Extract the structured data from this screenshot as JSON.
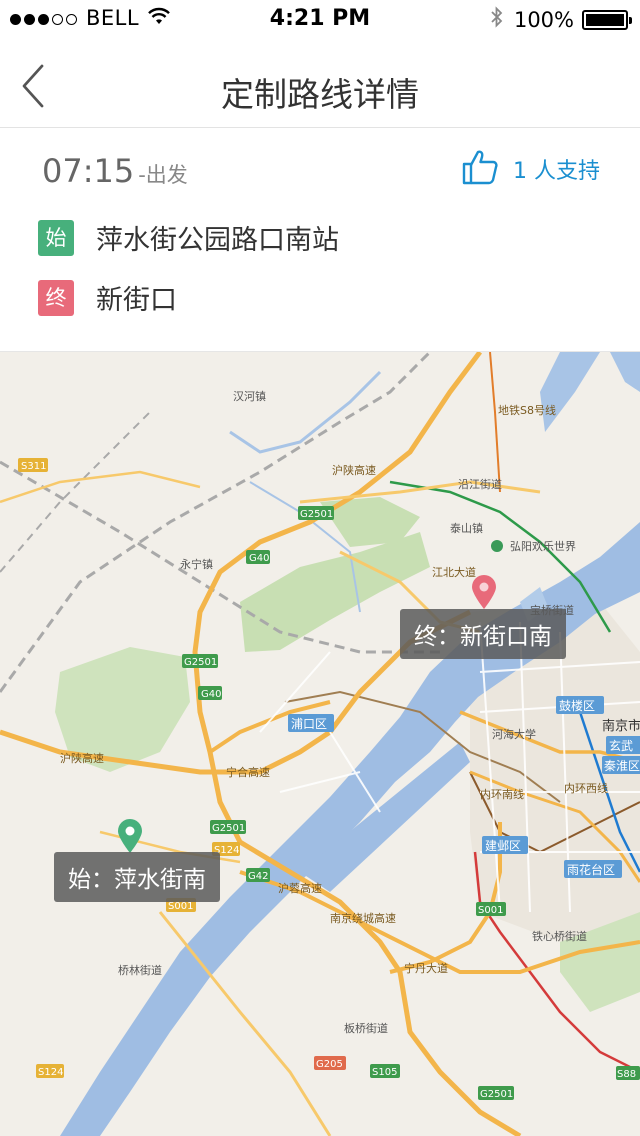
{
  "status_bar": {
    "carrier": "BELL",
    "time": "4:21 PM",
    "battery": "100%"
  },
  "nav": {
    "title": "定制路线详情"
  },
  "route": {
    "departure_time": "07:15",
    "departure_suffix": "-出发",
    "support_label": "1 人支持",
    "start_badge": "始",
    "start_name": "萍水街公园路口南站",
    "end_badge": "终",
    "end_name": "新街口"
  },
  "map": {
    "start_label": "始：萍水街南",
    "end_label": "终：新街口南",
    "places": {
      "hanhe": "汉河镇",
      "yongning": "永宁镇",
      "yanjiang": "沿江街道",
      "taishan": "泰山镇",
      "hongyang": "弘阳欢乐世界",
      "baoqiao": "宝桥街道",
      "pukou": "浦口区",
      "gulou": "鼓楼区",
      "nanjing": "南京市",
      "hohai": "河海大学",
      "xuanwu": "玄武",
      "qinhuai": "秦淮区",
      "jianye": "建邺区",
      "yuhuatai": "雨花台区",
      "tiexinqiao": "铁心桥街道",
      "qiaolin": "桥林街道",
      "banqiao": "板桥街道",
      "ningyu_hwy": "宁合高速",
      "hushan_hwy": "沪陕高速",
      "hushan_hwy2": "沪陕高速",
      "huning_hwy": "沪蓉高速",
      "nanjing_ring": "南京绕城高速",
      "inner_ring": "内环南线",
      "inner_ring_west": "内环西线",
      "ningdan": "宁丹大道",
      "metro_s8": "地铁S8号线",
      "jiangbei": "江北大道"
    },
    "road_shields": {
      "s311": "S311",
      "g2501_a": "G2501",
      "g40_a": "G40",
      "g2501_b": "G2501",
      "g40_b": "G40",
      "g2501_c": "G2501",
      "s124_a": "S124",
      "g42": "G42",
      "s001_a": "S001",
      "s001_b": "S001",
      "g205": "G205",
      "s105": "S105",
      "g2501_d": "G2501",
      "s124_b": "S124",
      "s88": "S88"
    },
    "colors": {
      "water": "#9fbde3",
      "land": "#f2efe9",
      "park": "#c7dfb1",
      "highway": "#f3b54a",
      "start_pin": "#47b07c",
      "end_pin": "#e86a7a"
    }
  }
}
